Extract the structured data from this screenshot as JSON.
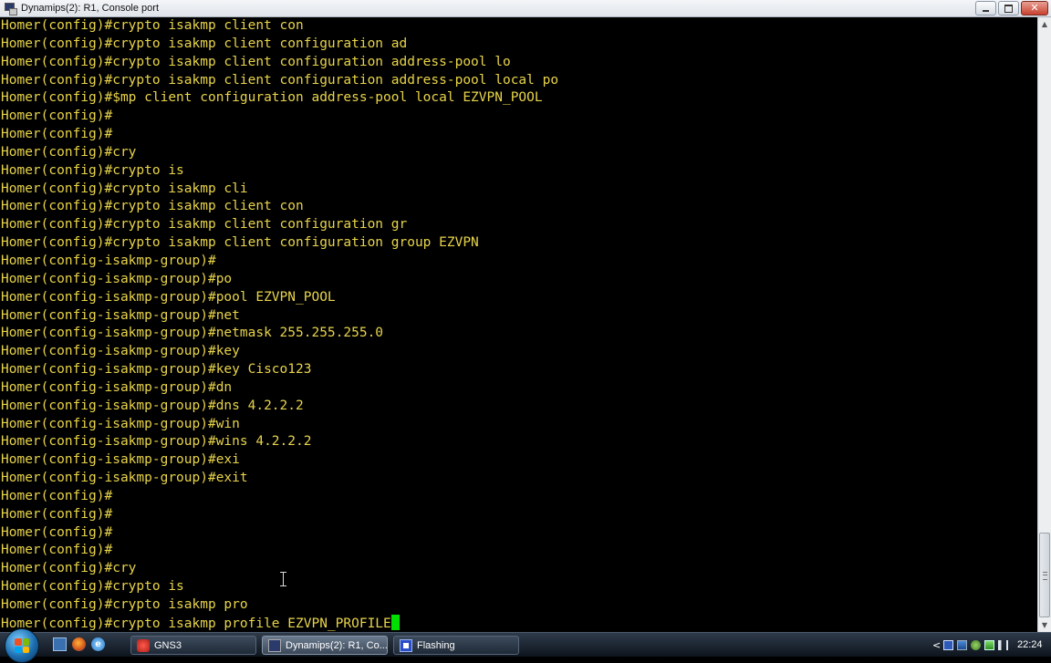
{
  "window": {
    "title": "Dynamips(2): R1, Console port"
  },
  "terminal": {
    "lines": [
      "Homer(config)#crypto isakmp client con",
      "Homer(config)#crypto isakmp client configuration ad",
      "Homer(config)#crypto isakmp client configuration address-pool lo",
      "Homer(config)#crypto isakmp client configuration address-pool local po",
      "Homer(config)#$mp client configuration address-pool local EZVPN_POOL",
      "Homer(config)#",
      "Homer(config)#",
      "Homer(config)#cry",
      "Homer(config)#crypto is",
      "Homer(config)#crypto isakmp cli",
      "Homer(config)#crypto isakmp client con",
      "Homer(config)#crypto isakmp client configuration gr",
      "Homer(config)#crypto isakmp client configuration group EZVPN",
      "Homer(config-isakmp-group)#",
      "Homer(config-isakmp-group)#po",
      "Homer(config-isakmp-group)#pool EZVPN_POOL",
      "Homer(config-isakmp-group)#net",
      "Homer(config-isakmp-group)#netmask 255.255.255.0",
      "Homer(config-isakmp-group)#key",
      "Homer(config-isakmp-group)#key Cisco123",
      "Homer(config-isakmp-group)#dn",
      "Homer(config-isakmp-group)#dns 4.2.2.2",
      "Homer(config-isakmp-group)#win",
      "Homer(config-isakmp-group)#wins 4.2.2.2",
      "Homer(config-isakmp-group)#exi",
      "Homer(config-isakmp-group)#exit",
      "Homer(config)#",
      "Homer(config)#",
      "Homer(config)#",
      "Homer(config)#",
      "Homer(config)#cry",
      "Homer(config)#crypto is",
      "Homer(config)#crypto isakmp pro"
    ],
    "current_input": "Homer(config)#crypto isakmp profile EZVPN_PROFILE",
    "text_color": "#e8d44a",
    "cursor_color": "#00e000"
  },
  "taskbar": {
    "tasks": [
      {
        "label": "GNS3",
        "icon": "gns3-icon"
      },
      {
        "label": "Dynamips(2): R1, Co...",
        "icon": "putty-icon"
      },
      {
        "label": "Flashing",
        "icon": "flashing-icon"
      }
    ],
    "clock": "22:24"
  }
}
